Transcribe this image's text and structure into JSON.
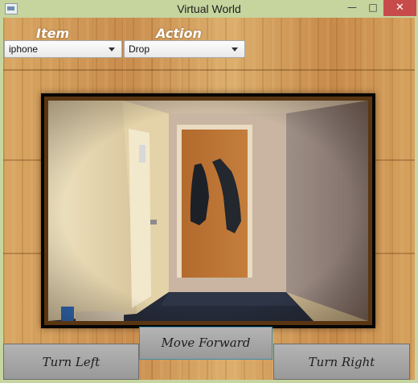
{
  "window": {
    "title": "Virtual World",
    "minimize_glyph": "—",
    "maximize_glyph": "□",
    "close_glyph": "✕"
  },
  "controls": {
    "item_label": "Item",
    "action_label": "Action",
    "item_selected": "iphone",
    "action_selected": "Drop"
  },
  "viewport": {
    "image": "hallway-photo"
  },
  "navigation": {
    "move_forward": "Move Forward",
    "turn_left": "Turn Left",
    "turn_right": "Turn Right"
  },
  "colors": {
    "titlebar": "#c6d49e",
    "close_button": "#c74b4b",
    "wood": "#d3a05e",
    "frame_border": "#050505",
    "button_face": "#a8a8a8"
  }
}
